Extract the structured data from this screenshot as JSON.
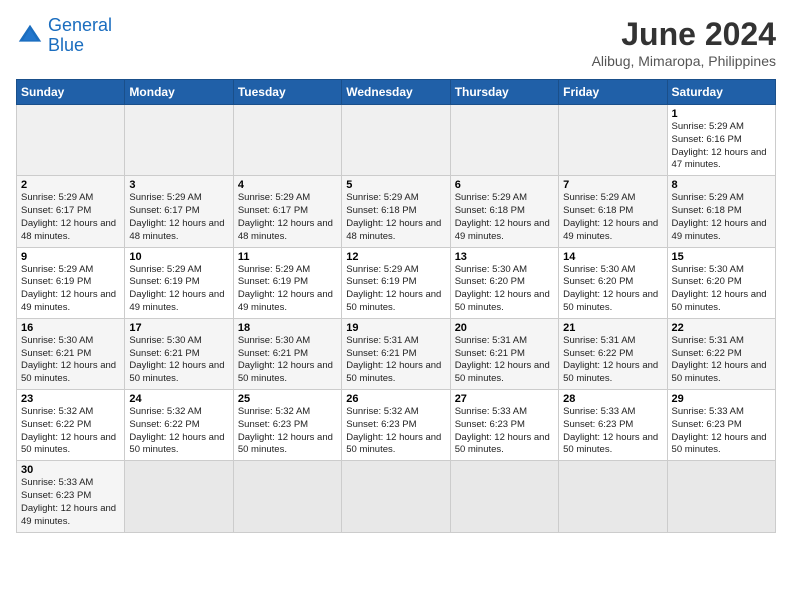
{
  "header": {
    "logo_general": "General",
    "logo_blue": "Blue",
    "title": "June 2024",
    "subtitle": "Alibug, Mimaropa, Philippines"
  },
  "days_of_week": [
    "Sunday",
    "Monday",
    "Tuesday",
    "Wednesday",
    "Thursday",
    "Friday",
    "Saturday"
  ],
  "weeks": [
    [
      {
        "day": "",
        "info": ""
      },
      {
        "day": "",
        "info": ""
      },
      {
        "day": "",
        "info": ""
      },
      {
        "day": "",
        "info": ""
      },
      {
        "day": "",
        "info": ""
      },
      {
        "day": "",
        "info": ""
      },
      {
        "day": "1",
        "info": "Sunrise: 5:29 AM\nSunset: 6:16 PM\nDaylight: 12 hours and 47 minutes."
      }
    ],
    [
      {
        "day": "2",
        "info": "Sunrise: 5:29 AM\nSunset: 6:17 PM\nDaylight: 12 hours and 48 minutes."
      },
      {
        "day": "3",
        "info": "Sunrise: 5:29 AM\nSunset: 6:17 PM\nDaylight: 12 hours and 48 minutes."
      },
      {
        "day": "4",
        "info": "Sunrise: 5:29 AM\nSunset: 6:17 PM\nDaylight: 12 hours and 48 minutes."
      },
      {
        "day": "5",
        "info": "Sunrise: 5:29 AM\nSunset: 6:18 PM\nDaylight: 12 hours and 48 minutes."
      },
      {
        "day": "6",
        "info": "Sunrise: 5:29 AM\nSunset: 6:18 PM\nDaylight: 12 hours and 49 minutes."
      },
      {
        "day": "7",
        "info": "Sunrise: 5:29 AM\nSunset: 6:18 PM\nDaylight: 12 hours and 49 minutes."
      },
      {
        "day": "8",
        "info": "Sunrise: 5:29 AM\nSunset: 6:18 PM\nDaylight: 12 hours and 49 minutes."
      }
    ],
    [
      {
        "day": "9",
        "info": "Sunrise: 5:29 AM\nSunset: 6:19 PM\nDaylight: 12 hours and 49 minutes."
      },
      {
        "day": "10",
        "info": "Sunrise: 5:29 AM\nSunset: 6:19 PM\nDaylight: 12 hours and 49 minutes."
      },
      {
        "day": "11",
        "info": "Sunrise: 5:29 AM\nSunset: 6:19 PM\nDaylight: 12 hours and 49 minutes."
      },
      {
        "day": "12",
        "info": "Sunrise: 5:29 AM\nSunset: 6:19 PM\nDaylight: 12 hours and 50 minutes."
      },
      {
        "day": "13",
        "info": "Sunrise: 5:30 AM\nSunset: 6:20 PM\nDaylight: 12 hours and 50 minutes."
      },
      {
        "day": "14",
        "info": "Sunrise: 5:30 AM\nSunset: 6:20 PM\nDaylight: 12 hours and 50 minutes."
      },
      {
        "day": "15",
        "info": "Sunrise: 5:30 AM\nSunset: 6:20 PM\nDaylight: 12 hours and 50 minutes."
      }
    ],
    [
      {
        "day": "16",
        "info": "Sunrise: 5:30 AM\nSunset: 6:21 PM\nDaylight: 12 hours and 50 minutes."
      },
      {
        "day": "17",
        "info": "Sunrise: 5:30 AM\nSunset: 6:21 PM\nDaylight: 12 hours and 50 minutes."
      },
      {
        "day": "18",
        "info": "Sunrise: 5:30 AM\nSunset: 6:21 PM\nDaylight: 12 hours and 50 minutes."
      },
      {
        "day": "19",
        "info": "Sunrise: 5:31 AM\nSunset: 6:21 PM\nDaylight: 12 hours and 50 minutes."
      },
      {
        "day": "20",
        "info": "Sunrise: 5:31 AM\nSunset: 6:21 PM\nDaylight: 12 hours and 50 minutes."
      },
      {
        "day": "21",
        "info": "Sunrise: 5:31 AM\nSunset: 6:22 PM\nDaylight: 12 hours and 50 minutes."
      },
      {
        "day": "22",
        "info": "Sunrise: 5:31 AM\nSunset: 6:22 PM\nDaylight: 12 hours and 50 minutes."
      }
    ],
    [
      {
        "day": "23",
        "info": "Sunrise: 5:32 AM\nSunset: 6:22 PM\nDaylight: 12 hours and 50 minutes."
      },
      {
        "day": "24",
        "info": "Sunrise: 5:32 AM\nSunset: 6:22 PM\nDaylight: 12 hours and 50 minutes."
      },
      {
        "day": "25",
        "info": "Sunrise: 5:32 AM\nSunset: 6:23 PM\nDaylight: 12 hours and 50 minutes."
      },
      {
        "day": "26",
        "info": "Sunrise: 5:32 AM\nSunset: 6:23 PM\nDaylight: 12 hours and 50 minutes."
      },
      {
        "day": "27",
        "info": "Sunrise: 5:33 AM\nSunset: 6:23 PM\nDaylight: 12 hours and 50 minutes."
      },
      {
        "day": "28",
        "info": "Sunrise: 5:33 AM\nSunset: 6:23 PM\nDaylight: 12 hours and 50 minutes."
      },
      {
        "day": "29",
        "info": "Sunrise: 5:33 AM\nSunset: 6:23 PM\nDaylight: 12 hours and 50 minutes."
      }
    ],
    [
      {
        "day": "30",
        "info": "Sunrise: 5:33 AM\nSunset: 6:23 PM\nDaylight: 12 hours and 49 minutes."
      },
      {
        "day": "",
        "info": ""
      },
      {
        "day": "",
        "info": ""
      },
      {
        "day": "",
        "info": ""
      },
      {
        "day": "",
        "info": ""
      },
      {
        "day": "",
        "info": ""
      },
      {
        "day": "",
        "info": ""
      }
    ]
  ]
}
